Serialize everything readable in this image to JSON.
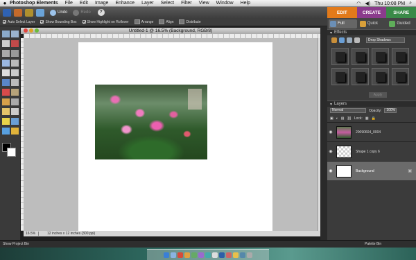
{
  "menubar": {
    "app_name": "Photoshop Elements",
    "items": [
      "File",
      "Edit",
      "Image",
      "Enhance",
      "Layer",
      "Select",
      "Filter",
      "View",
      "Window",
      "Help"
    ],
    "clock": "Thu 10:08 PM"
  },
  "toolbar": {
    "undo": "Undo",
    "redo": "Redo",
    "help": "?"
  },
  "mode_tabs": [
    {
      "label": "EDIT",
      "color": "#e27a1a"
    },
    {
      "label": "CREATE",
      "color": "#8a3b8c"
    },
    {
      "label": "SHARE",
      "color": "#3a8a48"
    }
  ],
  "options": {
    "auto_select": "Auto Select Layer",
    "bounding_box": "Show Bounding Box",
    "highlight": "Show Highlight on Rollover",
    "arrange": "Arrange",
    "align": "Align",
    "distribute": "Distribute"
  },
  "document": {
    "title": "Untitled-1 @ 16.5% (Background, RGB/8)",
    "zoom": "16.5%",
    "info": "12 inches x 12 inches (300 ppi)"
  },
  "panel": {
    "subtabs": [
      "Full",
      "Quick",
      "Guided"
    ],
    "effects_title": "Effects",
    "effects_dropdown": "Drop Shadows",
    "apply": "Apply",
    "layers_title": "Layers",
    "blend_mode": "Normal",
    "opacity_label": "Opacity:",
    "opacity_value": "100%",
    "lock_label": "Lock:",
    "layers": [
      {
        "name": "20090604_0004",
        "selected": false
      },
      {
        "name": "Shape 1 copy 6",
        "selected": false
      },
      {
        "name": "Background",
        "selected": true
      }
    ]
  },
  "bin": {
    "project_bin": "Show Project Bin",
    "palette_bin": "Palette Bin"
  }
}
